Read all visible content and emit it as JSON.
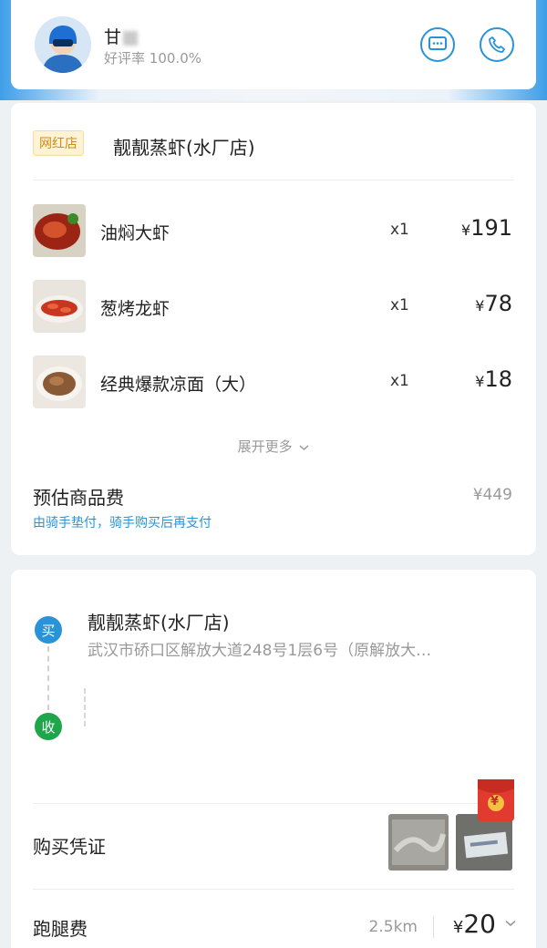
{
  "rider": {
    "name": "甘",
    "rating_label": "好评率",
    "rating_value": "100.0%"
  },
  "order": {
    "tag": "网红店",
    "shop_name": "靓靓蒸虾(水厂店)",
    "items": [
      {
        "name": "油焖大虾",
        "qty": "x1",
        "currency": "¥",
        "price": "191"
      },
      {
        "name": "葱烤龙虾",
        "qty": "x1",
        "currency": "¥",
        "price": "78"
      },
      {
        "name": "经典爆款凉面（大）",
        "qty": "x1",
        "currency": "¥",
        "price": "18"
      }
    ],
    "expand_more": "展开更多",
    "estimate_label": "预估商品费",
    "estimate_value": "¥449",
    "estimate_note": "由骑手垫付，骑手购买后再支付"
  },
  "route": {
    "buy_badge": "买",
    "receive_badge": "收",
    "shop_name": "靓靓蒸虾(水厂店)",
    "address": "武汉市硚口区解放大道248号1层6号（原解放大…",
    "proof_label": "购买凭证",
    "red_envelope_symbol": "¥",
    "fee_label": "跑腿费",
    "distance": "2.5km",
    "fee_currency": "¥",
    "fee_value": "20"
  },
  "colors": {
    "accent_blue": "#2a93d8",
    "receive_green": "#1fa64a",
    "tag_orange": "#d08a1a",
    "red_envelope": "#e23a2e"
  }
}
